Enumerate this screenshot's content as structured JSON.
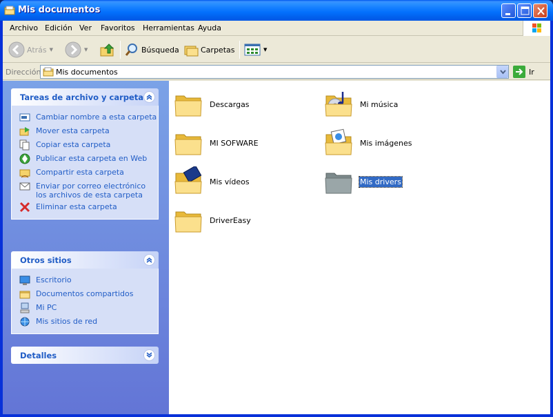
{
  "window": {
    "title": "Mis documentos"
  },
  "menu": [
    "Archivo",
    "Edición",
    "Ver",
    "Favoritos",
    "Herramientas",
    "Ayuda"
  ],
  "toolbar": {
    "back": "Atrás",
    "search": "Búsqueda",
    "folders": "Carpetas"
  },
  "address": {
    "label": "Dirección",
    "value": "Mis documentos",
    "go": "Ir"
  },
  "panels": {
    "tasks": {
      "title": "Tareas de archivo y carpeta",
      "items": [
        "Cambiar nombre a esta carpeta",
        "Mover esta carpeta",
        "Copiar esta carpeta",
        "Publicar esta carpeta en Web",
        "Compartir esta carpeta",
        "Enviar por correo electrónico los archivos de esta carpeta",
        "Eliminar esta carpeta"
      ]
    },
    "places": {
      "title": "Otros sitios",
      "items": [
        "Escritorio",
        "Documentos compartidos",
        "Mi PC",
        "Mis sitios de red"
      ]
    },
    "details": {
      "title": "Detalles"
    }
  },
  "files": [
    {
      "name": "Descargas",
      "icon": "folder-icon"
    },
    {
      "name": "Mi música",
      "icon": "music-folder-icon"
    },
    {
      "name": "MI SOFWARE",
      "icon": "folder-icon"
    },
    {
      "name": "Mis imágenes",
      "icon": "pictures-folder-icon"
    },
    {
      "name": "Mis vídeos",
      "icon": "videos-folder-icon"
    },
    {
      "name": "Mis drivers",
      "icon": "grey-folder-icon",
      "selected": true
    },
    {
      "name": "DriverEasy",
      "icon": "folder-icon"
    }
  ],
  "colors": {
    "titlebar": "#0058ee",
    "taskpane": "#7ba2e7",
    "link": "#215dc6",
    "selection": "#316ac5"
  }
}
